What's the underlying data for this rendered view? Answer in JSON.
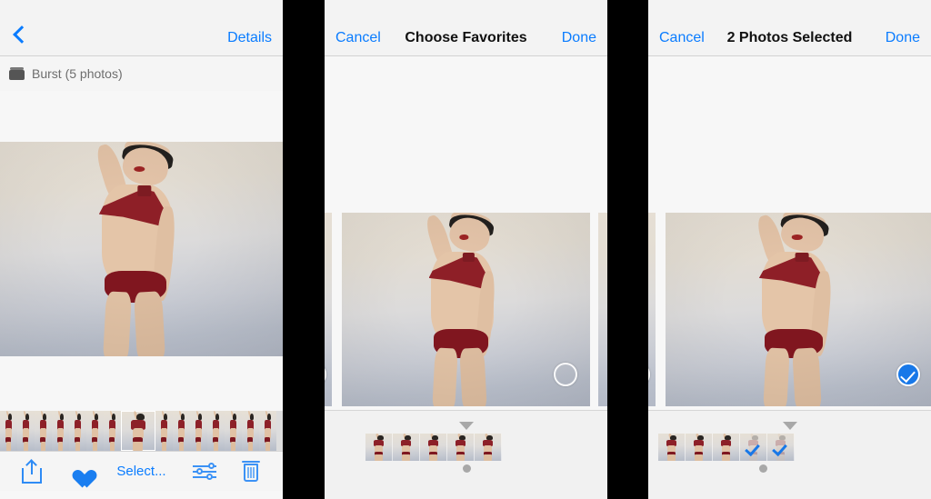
{
  "app": "Photos — Burst selection flow",
  "panels": [
    {
      "id": "viewer",
      "nav": {
        "back_icon": "chevron-left-icon",
        "right_label": "Details"
      },
      "burst": {
        "icon": "burst-stack-icon",
        "label": "Burst (5 photos)"
      },
      "toolbar": {
        "share_icon": "share-icon",
        "favorite_icon": "heart-filled-icon",
        "select_label": "Select...",
        "adjust_icon": "adjust-sliders-icon",
        "delete_icon": "trash-icon"
      },
      "filmstrip": {
        "count": 15,
        "selected_index": 7
      }
    },
    {
      "id": "choose-favorites",
      "nav": {
        "left_label": "Cancel",
        "title": "Choose Favorites",
        "right_label": "Done"
      },
      "selection": {
        "state": "unselected",
        "icon": "circle-outline-icon"
      },
      "filmstrip": {
        "count": 5,
        "current_index": 4,
        "checked": []
      }
    },
    {
      "id": "photos-selected",
      "nav": {
        "left_label": "Cancel",
        "title": "2 Photos Selected",
        "right_label": "Done"
      },
      "selection": {
        "state": "selected",
        "icon": "check-circle-filled-icon"
      },
      "filmstrip": {
        "count": 5,
        "current_index": 4,
        "checked": [
          3,
          4
        ]
      }
    }
  ],
  "colors": {
    "accent_blue": "#0a7cff",
    "selected_blue": "#1878e8",
    "bar_gray": "#f3f3f3",
    "body_gray": "#f7f7f7",
    "gutter": "#000000"
  }
}
